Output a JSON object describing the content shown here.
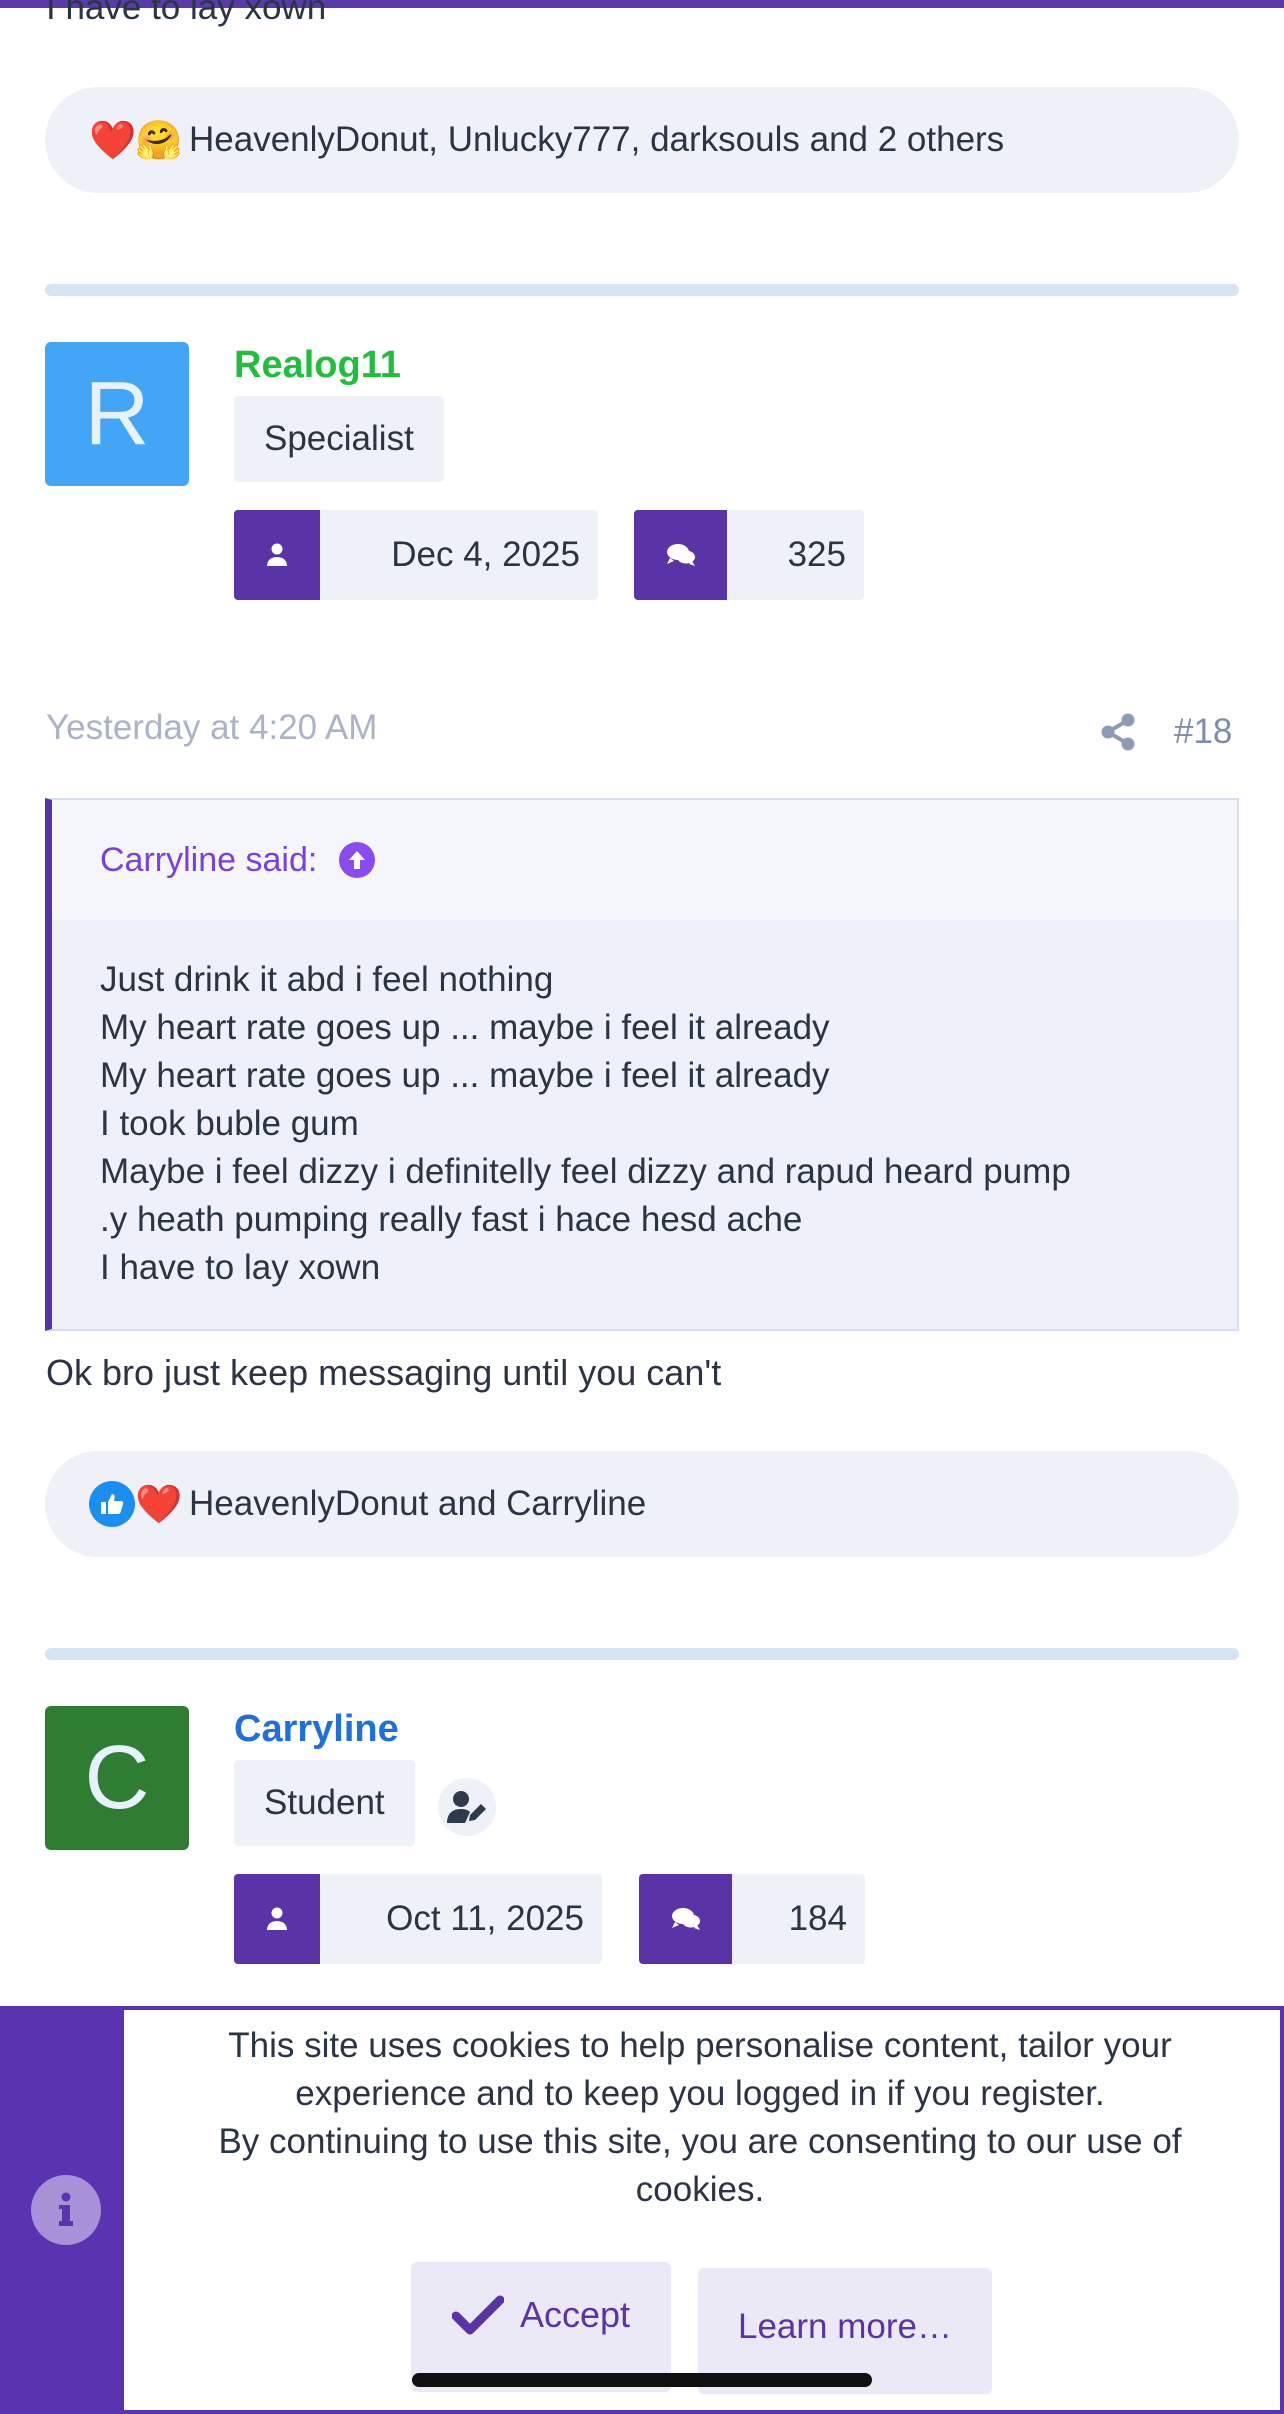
{
  "previous_post": {
    "last_line": "I have to lay xown",
    "reactions_text": "HeavenlyDonut, Unlucky777, darksouls and 2 others",
    "reaction_emojis": [
      "❤️",
      "🤗"
    ]
  },
  "post18": {
    "author": "Realog11",
    "author_color": "#1fbf3c",
    "avatar_letter": "R",
    "avatar_color": "#42a5f5",
    "role": "Specialist",
    "joined": "Dec 4, 2025",
    "messages": "325",
    "time": "Yesterday at 4:20 AM",
    "post_number": "#18",
    "quote": {
      "header": "Carryline said:",
      "lines": [
        "Just drink it abd i feel nothing",
        "My heart rate goes up ... maybe i feel it already",
        "My heart rate goes up ... maybe i feel it already",
        "I took buble gum",
        "Maybe i feel dizzy i definitelly feel dizzy and rapud heard pump",
        ".y heath pumping really fast i hace hesd ache",
        "I have to lay xown"
      ]
    },
    "body": "Ok bro just keep messaging until you can't",
    "reactions_text": "HeavenlyDonut and Carryline",
    "reaction_emojis": [
      "👍",
      "❤️"
    ]
  },
  "post19": {
    "author": "Carryline",
    "author_color": "#1e6fe0",
    "avatar_letter": "C",
    "avatar_color": "#2e7d32",
    "role": "Student",
    "joined": "Oct 11, 2025",
    "messages": "184"
  },
  "cookie_notice": {
    "line1": "This site uses cookies to help personalise content, tailor your experience and to keep you logged in if you register.",
    "line2": "By continuing to use this site, you are consenting to our use of cookies.",
    "accept_label": "Accept",
    "learn_more_label": "Learn more…"
  },
  "icons": {
    "user": "user-icon",
    "messages": "comments-icon",
    "share": "share-icon",
    "quote_jump": "arrow-up-circle-icon",
    "editor_badge": "user-edit-icon",
    "info": "info-icon",
    "check": "check-icon"
  },
  "colors": {
    "accent": "#5a34a6",
    "quote_accent": "#7a3fe0",
    "muted": "#aab4c6",
    "surface": "#eef1f7"
  }
}
